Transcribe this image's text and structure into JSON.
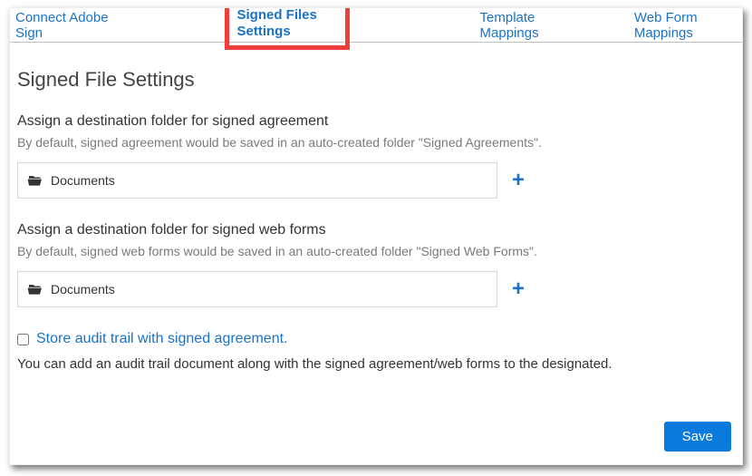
{
  "tabs": {
    "connect": "Connect Adobe Sign",
    "signed_settings": "Signed Files Settings",
    "template_mappings": "Template Mappings",
    "webform_mappings": "Web Form Mappings"
  },
  "page_title": "Signed File Settings",
  "agreement": {
    "label": "Assign a destination folder for signed agreement",
    "desc": "By default, signed agreement would be saved in an auto-created folder \"Signed Agreements\".",
    "folder_value": "Documents"
  },
  "webforms": {
    "label": "Assign a destination folder for signed web forms",
    "desc": "By default, signed web forms would be saved in an auto-created folder \"Signed Web Forms\".",
    "folder_value": "Documents"
  },
  "audit": {
    "checkbox_label": "Store audit trail with signed agreement.",
    "desc": "You can add an audit trail document along with the signed agreement/web forms to the designated."
  },
  "save_label": "Save",
  "icons": {
    "plus": "+"
  }
}
